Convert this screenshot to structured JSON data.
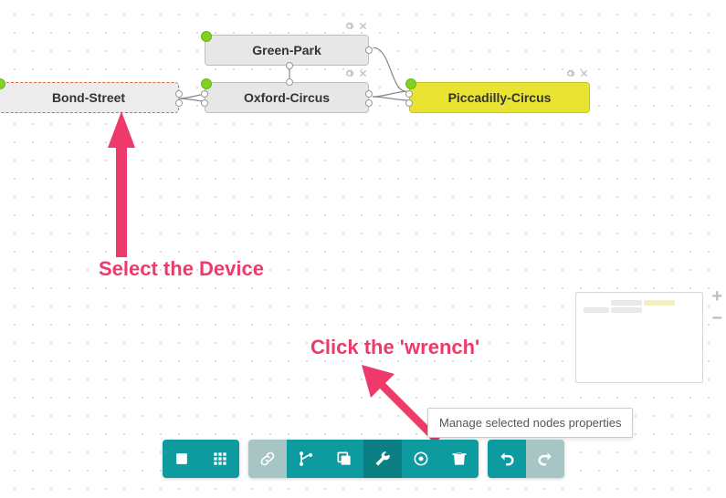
{
  "nodes": {
    "bond_street": {
      "label": "Bond-Street"
    },
    "green_park": {
      "label": "Green-Park"
    },
    "oxford_circus": {
      "label": "Oxford-Circus"
    },
    "piccadilly_circus": {
      "label": "Piccadilly-Circus"
    }
  },
  "annotations": {
    "select_device": "Select the Device",
    "click_wrench": "Click the 'wrench'"
  },
  "tooltip": {
    "wrench": "Manage selected nodes properties"
  },
  "icons": {
    "gear": "gear-icon",
    "close": "close-icon",
    "stop": "stop-icon",
    "grid": "grid-icon",
    "link": "link-icon",
    "branch": "branch-icon",
    "copy": "copy-icon",
    "wrench": "wrench-icon",
    "target": "target-icon",
    "trash": "trash-icon",
    "undo": "undo-icon",
    "redo": "redo-icon",
    "plus": "plus-icon",
    "minus": "minus-icon"
  },
  "colors": {
    "accent": "#0d9ba0",
    "annotation": "#ee3a6a",
    "selected_border": "#e0663b",
    "highlight_bg": "#e8e431",
    "status_up": "#7ed321"
  }
}
